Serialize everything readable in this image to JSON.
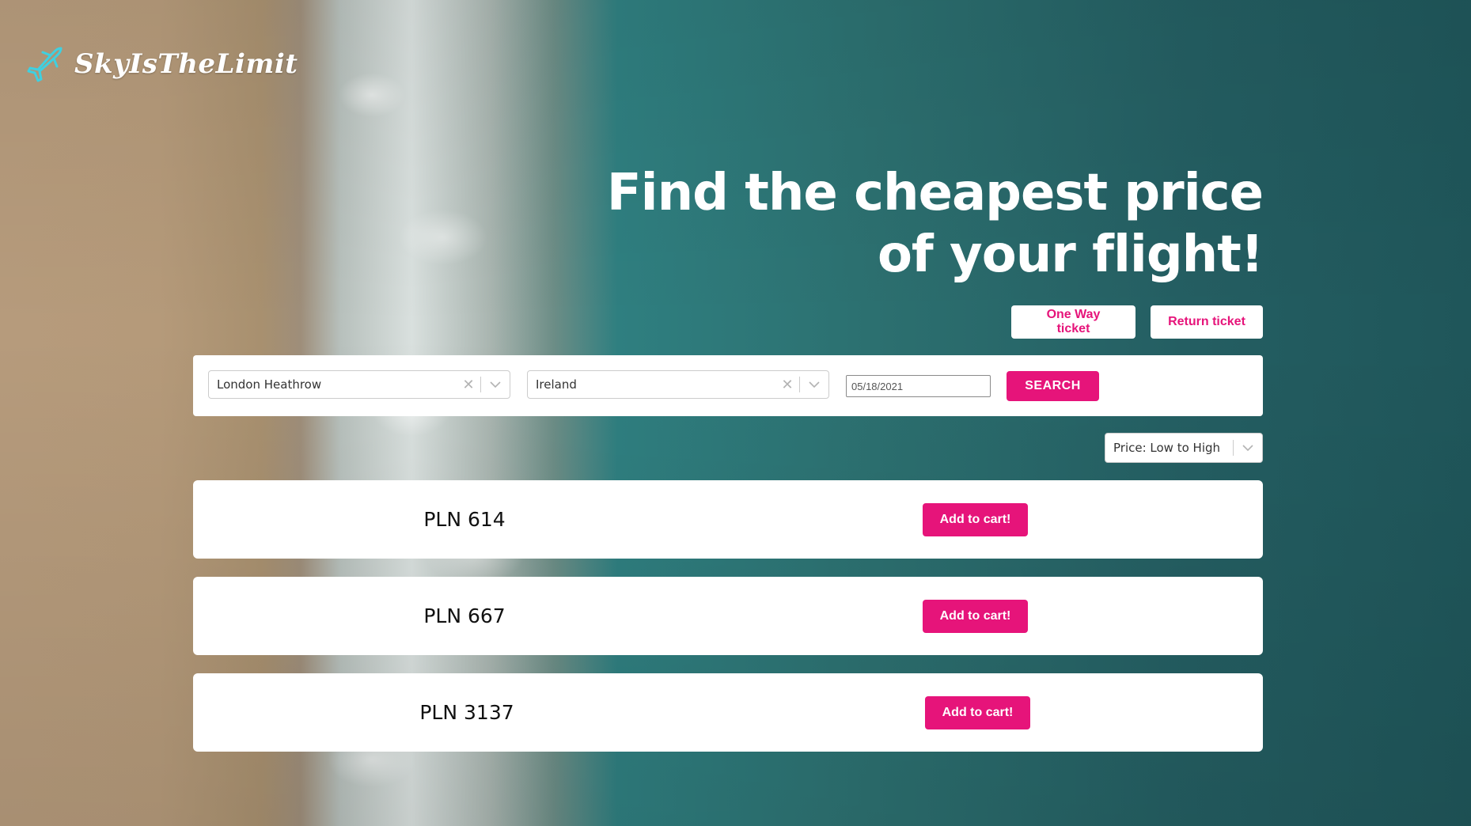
{
  "brand": {
    "name": "SkyIsTheLimit",
    "accent_color": "#e6147a",
    "logo_icon": "plane-icon"
  },
  "hero": {
    "line1": "Find the cheapest price",
    "line2": "of your flight!"
  },
  "ticket_types": [
    {
      "label": "One Way ticket"
    },
    {
      "label": "Return ticket"
    }
  ],
  "search": {
    "from": {
      "value": "London Heathrow",
      "clear_icon": "clear-icon",
      "dropdown_icon": "chevron-down-icon"
    },
    "to": {
      "value": "Ireland",
      "clear_icon": "clear-icon",
      "dropdown_icon": "chevron-down-icon"
    },
    "date": {
      "value": "05/18/2021"
    },
    "button_label": "SEARCH"
  },
  "sort": {
    "selected": "Price: Low to High"
  },
  "results": [
    {
      "price": "PLN 614",
      "button_label": "Add to cart!"
    },
    {
      "price": "PLN 667",
      "button_label": "Add to cart!"
    },
    {
      "price": "PLN 3137",
      "button_label": "Add to cart!"
    }
  ]
}
